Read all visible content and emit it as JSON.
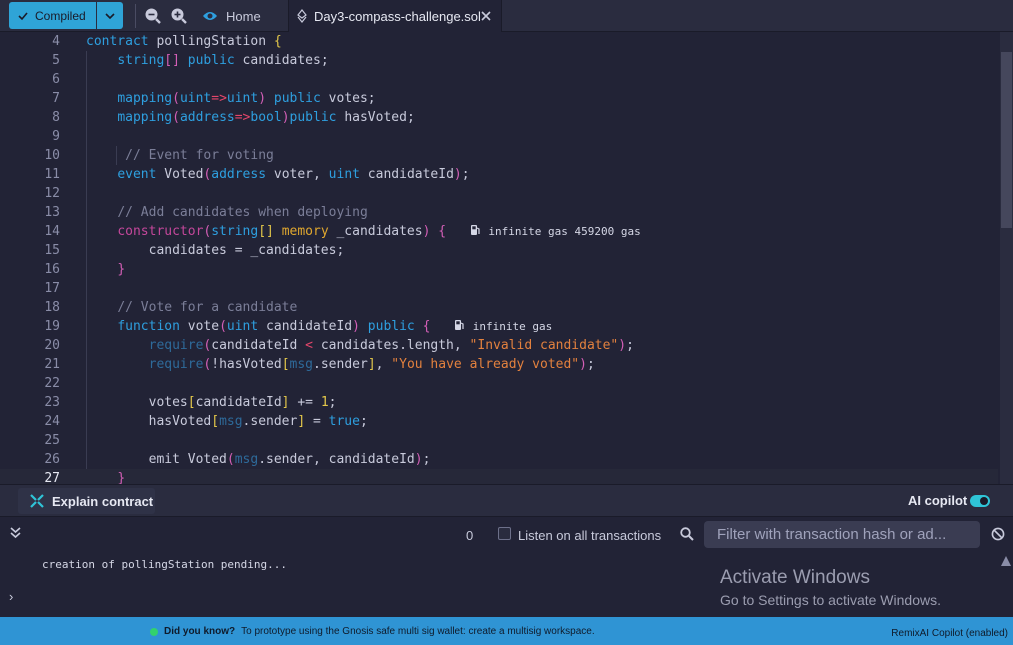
{
  "toolbar": {
    "compile_label": "Compiled",
    "home_tab": "Home",
    "file_tab": "Day3-compass-challenge.sol"
  },
  "editor": {
    "lines": [
      {
        "n": "4"
      },
      {
        "n": "5"
      },
      {
        "n": "6"
      },
      {
        "n": "7"
      },
      {
        "n": "8"
      },
      {
        "n": "9"
      },
      {
        "n": "10"
      },
      {
        "n": "11"
      },
      {
        "n": "12"
      },
      {
        "n": "13"
      },
      {
        "n": "14",
        "gas": "infinite gas 459200 gas"
      },
      {
        "n": "15"
      },
      {
        "n": "16"
      },
      {
        "n": "17"
      },
      {
        "n": "18"
      },
      {
        "n": "19",
        "gas": "infinite gas"
      },
      {
        "n": "20"
      },
      {
        "n": "21"
      },
      {
        "n": "22"
      },
      {
        "n": "23"
      },
      {
        "n": "24"
      },
      {
        "n": "25"
      },
      {
        "n": "26"
      },
      {
        "n": "27"
      }
    ],
    "current_line": "27"
  },
  "aibar": {
    "explain_label": "Explain contract",
    "copilot_label": "AI copilot",
    "copilot_enabled": true
  },
  "terminal": {
    "count": "0",
    "listen_label": "Listen on all transactions",
    "filter_placeholder": "Filter with transaction hash or ad...",
    "log": "creation of pollingStation pending...",
    "prompt": "›"
  },
  "watermark": {
    "line1": "Activate Windows",
    "line2": "Go to Settings to activate Windows."
  },
  "statusbar": {
    "did_you_know": "Did you know?",
    "tip": "To prototype using the Gnosis safe multi sig wallet: create a multisig workspace.",
    "copilot_status": "RemixAI Copilot (enabled)"
  },
  "colors": {
    "accent": "#2fa4d7",
    "status_bar": "#2f94d4",
    "editor_bg": "#222336"
  },
  "icons": [
    "check-icon",
    "chevron-down-icon",
    "zoom-out-icon",
    "zoom-in-icon",
    "remix-logo-icon",
    "file-icon",
    "close-icon",
    "explain-icon",
    "double-chevron-icon",
    "search-icon",
    "clear-icon",
    "gas-pump-icon"
  ]
}
